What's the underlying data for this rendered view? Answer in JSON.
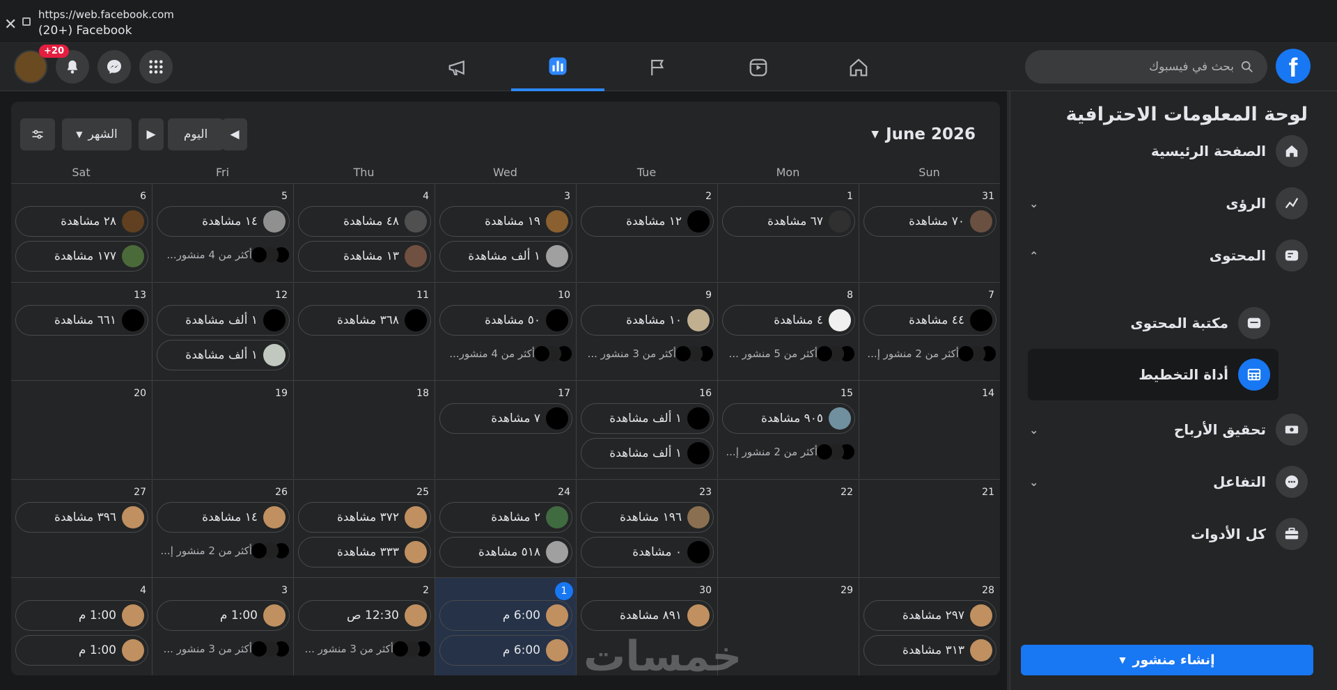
{
  "browser": {
    "url": "https://web.facebook.com",
    "title": "(20+) Facebook"
  },
  "topnav": {
    "search_placeholder": "بحث في فيسبوك",
    "notif_badge": "+20"
  },
  "sidebar": {
    "title": "لوحة المعلومات الاحترافية",
    "items": [
      {
        "label": "الصفحة الرئيسية"
      },
      {
        "label": "الرؤى"
      },
      {
        "label": "المحتوى"
      },
      {
        "label": "مكتبة المحتوى"
      },
      {
        "label": "أداة التخطيط"
      },
      {
        "label": "تحقيق الأرباح"
      },
      {
        "label": "التفاعل"
      },
      {
        "label": "كل الأدوات"
      }
    ],
    "create_label": "إنشاء منشور"
  },
  "calendar": {
    "month_label": "June 2026",
    "today_label": "اليوم",
    "view_label": "الشهر",
    "days": [
      "Sun",
      "Mon",
      "Tue",
      "Wed",
      "Thu",
      "Fri",
      "Sat"
    ],
    "weeks": [
      [
        {
          "d": "31",
          "items": [
            {
              "t": "٧٠ مشاهدة",
              "c": "#6a5040"
            }
          ]
        },
        {
          "d": "1",
          "items": [
            {
              "t": "٦٧ مشاهدة",
              "c": "#303030"
            }
          ]
        },
        {
          "d": "2",
          "items": [
            {
              "t": "١٢ مشاهدة",
              "c": "#000"
            }
          ]
        },
        {
          "d": "3",
          "items": [
            {
              "t": "١٩ مشاهدة",
              "c": "#8a6030"
            },
            {
              "t": "١ ألف مشاهدة",
              "c": "#a0a0a0"
            }
          ]
        },
        {
          "d": "4",
          "items": [
            {
              "t": "٤٨ مشاهدة",
              "c": "#505050"
            },
            {
              "t": "١٣ مشاهدة",
              "c": "#705040"
            }
          ]
        },
        {
          "d": "5",
          "items": [
            {
              "t": "١٤ مشاهدة",
              "c": "#909090"
            }
          ],
          "more": "أكثر من 4 منشور..."
        },
        {
          "d": "6",
          "items": [
            {
              "t": "٢٨ مشاهدة",
              "c": "#604020"
            },
            {
              "t": "١٧٧ مشاهدة",
              "c": "#4a6a3a"
            }
          ]
        }
      ],
      [
        {
          "d": "7",
          "items": [
            {
              "t": "٤٤ مشاهدة",
              "c": "#000"
            }
          ],
          "more": "أكثر من 2 منشور إ..."
        },
        {
          "d": "8",
          "items": [
            {
              "t": "٤ مشاهدة",
              "c": "#f0f0f0"
            }
          ],
          "more": "أكثر من 5 منشور ..."
        },
        {
          "d": "9",
          "items": [
            {
              "t": "١٠ مشاهدة",
              "c": "#c0b090"
            }
          ],
          "more": "أكثر من 3 منشور ..."
        },
        {
          "d": "10",
          "items": [
            {
              "t": "٥٠ مشاهدة",
              "c": "#000"
            }
          ],
          "more": "أكثر من 4 منشور..."
        },
        {
          "d": "11",
          "items": [
            {
              "t": "٣٦٨ مشاهدة",
              "c": "#000"
            }
          ]
        },
        {
          "d": "12",
          "items": [
            {
              "t": "١ ألف مشاهدة",
              "c": "#000"
            },
            {
              "t": "١ ألف مشاهدة",
              "c": "#c0c8c0"
            }
          ]
        },
        {
          "d": "13",
          "items": [
            {
              "t": "٦٦١ مشاهدة",
              "c": "#000"
            }
          ]
        }
      ],
      [
        {
          "d": "14",
          "items": []
        },
        {
          "d": "15",
          "items": [
            {
              "t": "٩٠٥ مشاهدة",
              "c": "#7090a0"
            }
          ],
          "more": "أكثر من 2 منشور إ..."
        },
        {
          "d": "16",
          "items": [
            {
              "t": "١ ألف مشاهدة",
              "c": "#000"
            },
            {
              "t": "١ ألف مشاهدة",
              "c": "#000"
            }
          ]
        },
        {
          "d": "17",
          "items": [
            {
              "t": "٧ مشاهدة",
              "c": "#000"
            }
          ]
        },
        {
          "d": "18",
          "items": []
        },
        {
          "d": "19",
          "items": []
        },
        {
          "d": "20",
          "items": []
        }
      ],
      [
        {
          "d": "21",
          "items": []
        },
        {
          "d": "22",
          "items": []
        },
        {
          "d": "23",
          "items": [
            {
              "t": "١٩٦ مشاهدة",
              "c": "#8a7050"
            },
            {
              "t": "٠ مشاهدة",
              "c": "#000"
            }
          ]
        },
        {
          "d": "24",
          "items": [
            {
              "t": "٢ مشاهدة",
              "c": "#406a40"
            },
            {
              "t": "٥١٨ مشاهدة",
              "c": "#a0a0a0"
            }
          ]
        },
        {
          "d": "25",
          "items": [
            {
              "t": "٣٧٢ مشاهدة",
              "c": "#c09060"
            },
            {
              "t": "٣٣٣ مشاهدة",
              "c": "#c09060"
            }
          ]
        },
        {
          "d": "26",
          "items": [
            {
              "t": "١٤ مشاهدة",
              "c": "#c09060"
            }
          ],
          "more": "أكثر من 2 منشور إ..."
        },
        {
          "d": "27",
          "items": [
            {
              "t": "٣٩٦ مشاهدة",
              "c": "#c09060"
            }
          ]
        }
      ],
      [
        {
          "d": "28",
          "items": [
            {
              "t": "٢٩٧ مشاهدة",
              "c": "#c09060"
            },
            {
              "t": "٣١٣ مشاهدة",
              "c": "#c09060"
            }
          ]
        },
        {
          "d": "29",
          "items": []
        },
        {
          "d": "30",
          "items": [
            {
              "t": "٨٩١ مشاهدة",
              "c": "#c09060"
            }
          ]
        },
        {
          "d": "1",
          "today": true,
          "items": [
            {
              "t": "6:00 م",
              "c": "#c09060"
            },
            {
              "t": "6:00 م",
              "c": "#c09060"
            }
          ]
        },
        {
          "d": "2",
          "items": [
            {
              "t": "12:30 ص",
              "c": "#c09060"
            }
          ],
          "more": "أكثر من 3 منشور ..."
        },
        {
          "d": "3",
          "items": [
            {
              "t": "1:00 م",
              "c": "#c09060"
            }
          ],
          "more": "أكثر من 3 منشور ..."
        },
        {
          "d": "4",
          "items": [
            {
              "t": "1:00 م",
              "c": "#c09060"
            },
            {
              "t": "1:00 م",
              "c": "#c09060"
            }
          ]
        }
      ]
    ]
  },
  "watermark": "خمسات"
}
